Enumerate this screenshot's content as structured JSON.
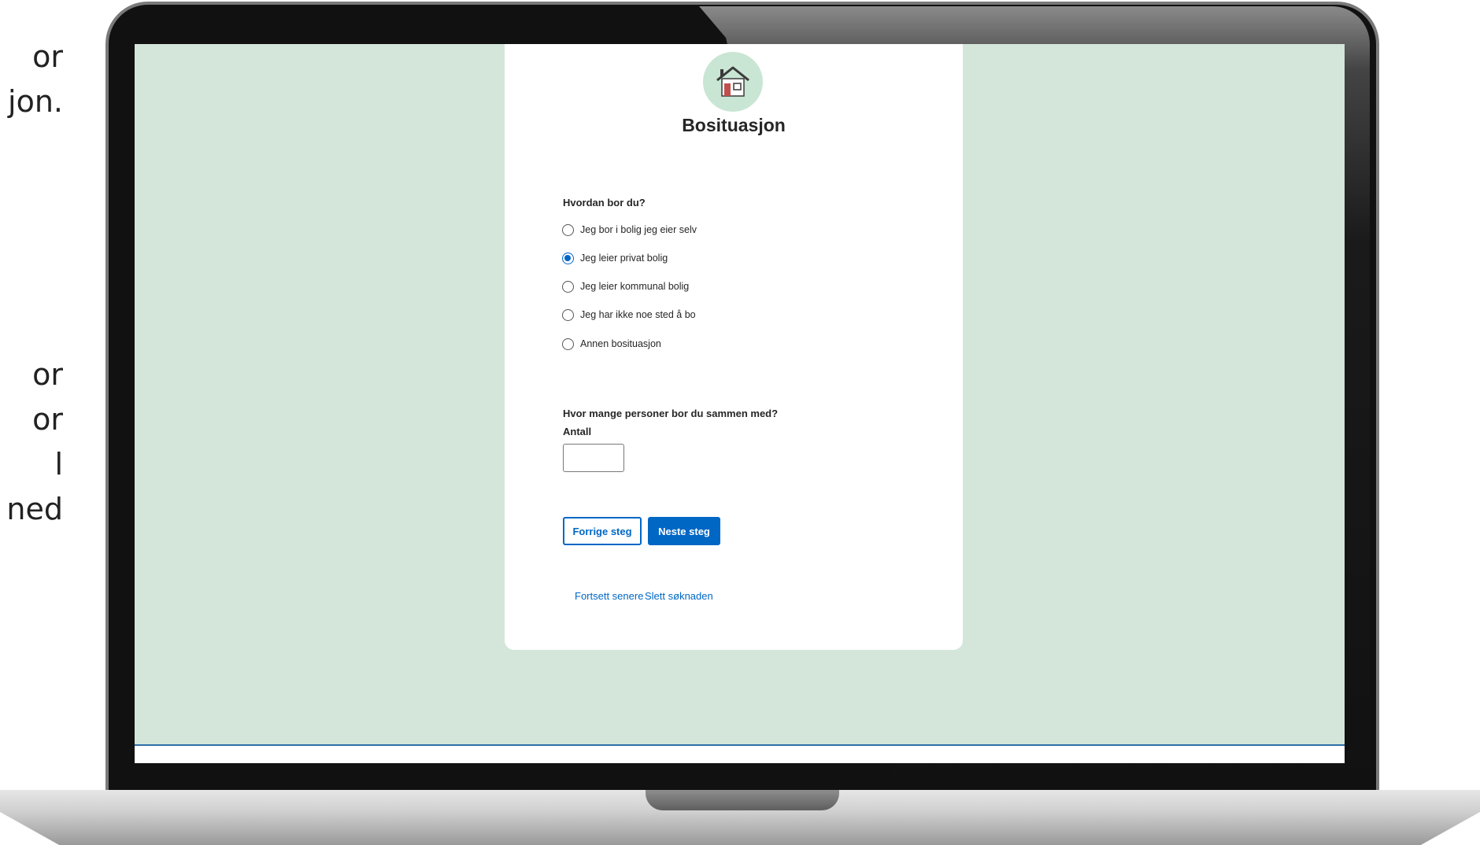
{
  "slide_text": {
    "top_lines": [
      "or",
      "jon."
    ],
    "mid_lines": [
      "or",
      "or",
      "l",
      "ned"
    ]
  },
  "page": {
    "title": "Bosituasjon",
    "logo_icon": "house-icon"
  },
  "housing_question": {
    "label": "Hvordan bor du?",
    "options": [
      {
        "label": "Jeg bor i bolig jeg eier selv",
        "checked": false
      },
      {
        "label": "Jeg leier privat bolig",
        "checked": true
      },
      {
        "label": "Jeg leier kommunal bolig",
        "checked": false
      },
      {
        "label": "Jeg har ikke noe sted å bo",
        "checked": false
      },
      {
        "label": "Annen bosituasjon",
        "checked": false
      }
    ]
  },
  "persons_question": {
    "label": "Hvor mange personer bor du sammen med?",
    "field_label": "Antall",
    "value": ""
  },
  "buttons": {
    "previous": "Forrige steg",
    "next": "Neste steg"
  },
  "links": {
    "continue_later": "Fortsett senere",
    "delete": "Slett søknaden"
  },
  "colors": {
    "background": "#d4e6da",
    "accent": "#0067c5",
    "logo_bg": "#c9e5d4"
  }
}
